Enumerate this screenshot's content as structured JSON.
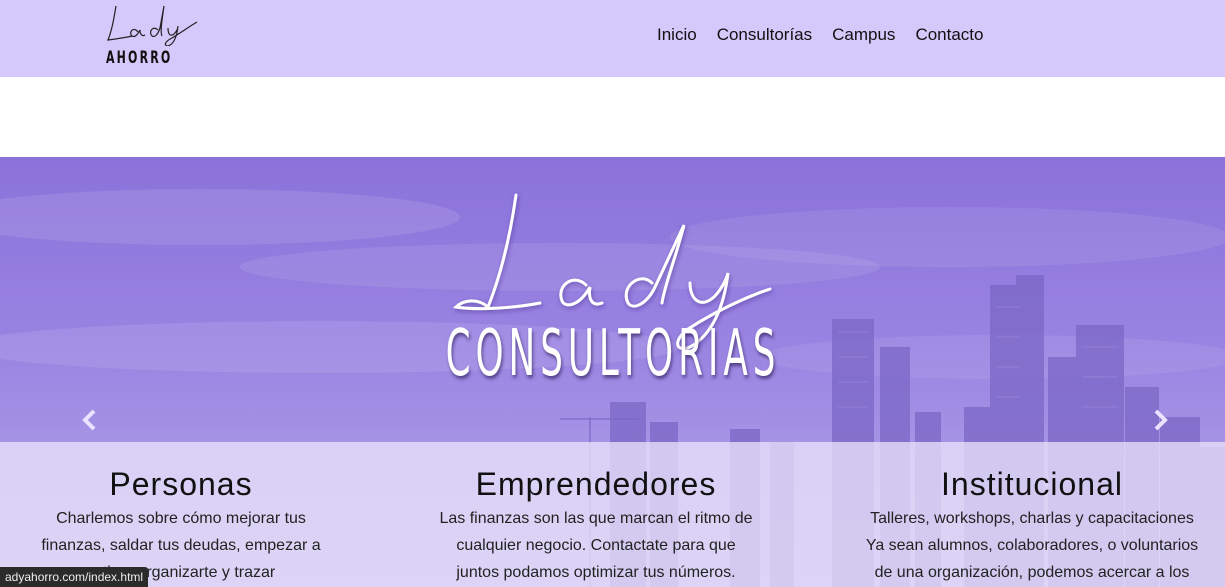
{
  "nav": {
    "logo": {
      "script": "Lady",
      "word": "AHORRO"
    },
    "links": [
      "Inicio",
      "Consultorías",
      "Campus",
      "Contacto"
    ]
  },
  "hero": {
    "script": "Lady",
    "title": "CONSULTORIAS"
  },
  "cards": [
    {
      "title": "Personas",
      "lines": [
        "Charlemos sobre cómo mejorar tus",
        "finanzas, saldar tus deudas, empezar a",
        "…tir, a organizarte y trazar"
      ]
    },
    {
      "title": "Emprendedores",
      "lines": [
        "Las finanzas son las que marcan el ritmo de",
        "cualquier negocio. Contactate para que",
        "juntos podamos optimizar tus números."
      ]
    },
    {
      "title": "Institucional",
      "lines": [
        "Talleres, workshops, charlas y capacitaciones",
        "Ya sean alumnos, colaboradores, o voluntarios",
        "de una organización, podemos  acercar a los"
      ]
    }
  ],
  "status": {
    "url": "adyahorro.com/index.html"
  },
  "colors": {
    "navbar": "#d5c8fb",
    "hero": "#8a72da"
  }
}
